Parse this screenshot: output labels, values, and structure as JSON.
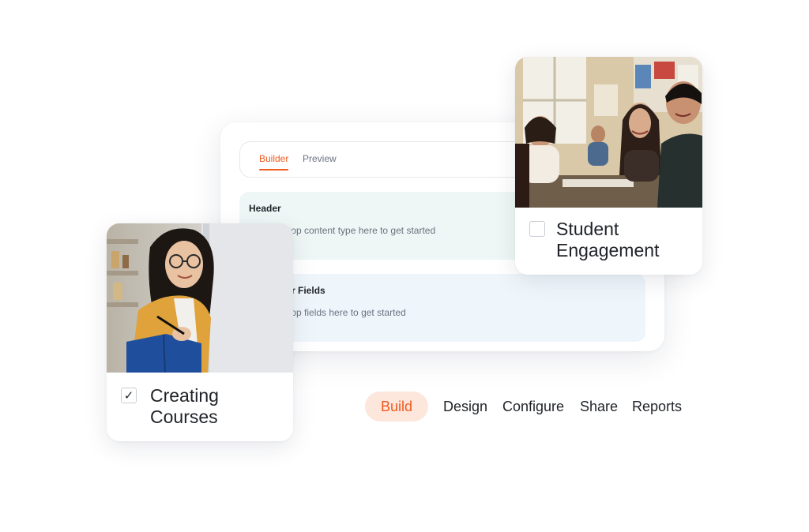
{
  "builder": {
    "tabs": [
      {
        "label": "Builder",
        "active": true
      },
      {
        "label": "Preview",
        "active": false
      }
    ],
    "zones": [
      {
        "title": "Header",
        "hint": "Drag & Drop content type here to get started"
      },
      {
        "title": "Calculator Fields",
        "hint": "Drag & Drop fields here to get started"
      }
    ]
  },
  "cards": [
    {
      "label": "Creating Courses",
      "checked": true,
      "check_glyph": "✓",
      "photo": "student-writing-photo"
    },
    {
      "label": "Student Engagement",
      "checked": false,
      "check_glyph": "",
      "photo": "classroom-photo"
    }
  ],
  "nav": {
    "items": [
      {
        "label": "Build",
        "active": true
      },
      {
        "label": "Design",
        "active": false
      },
      {
        "label": "Configure",
        "active": false
      },
      {
        "label": "Share",
        "active": false
      },
      {
        "label": "Reports",
        "active": false
      }
    ]
  },
  "colors": {
    "accent": "#f05a1f",
    "accent_soft": "#fde7dc",
    "header_zone": "#eef7f5",
    "calc_zone": "#eff6fb"
  }
}
